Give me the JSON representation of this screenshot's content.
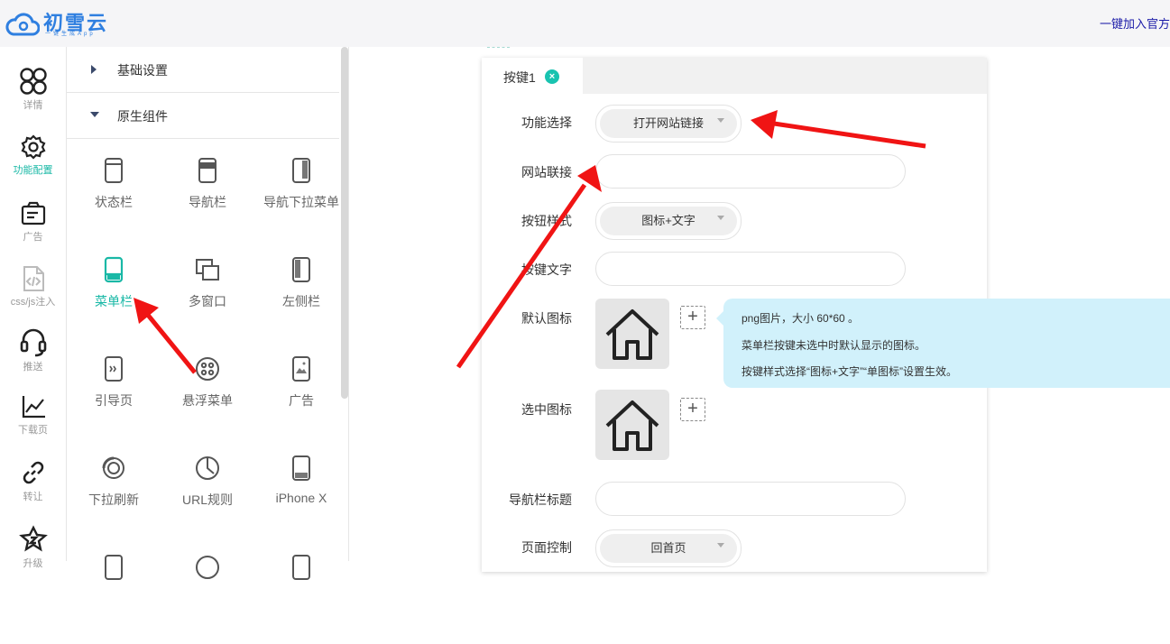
{
  "header": {
    "logo_name": "初雪云",
    "logo_sub": "一键生成App",
    "link": "一键加入官方"
  },
  "leftnav": [
    {
      "label": "详情",
      "icon": "clover-icon"
    },
    {
      "label": "功能配置",
      "icon": "gear-icon",
      "active": true
    },
    {
      "label": "广告",
      "icon": "ad-card-icon"
    },
    {
      "label": "css/js注入",
      "icon": "code-file-icon"
    },
    {
      "label": "推送",
      "icon": "headset-icon"
    },
    {
      "label": "下载页",
      "icon": "line-chart-icon"
    },
    {
      "label": "转让",
      "icon": "link-icon"
    },
    {
      "label": "升级",
      "icon": "star-badge-icon"
    }
  ],
  "panel": {
    "sections": [
      "基础设置",
      "原生组件"
    ],
    "components": [
      {
        "label": "状态栏",
        "icon": "status-bar-icon"
      },
      {
        "label": "导航栏",
        "icon": "nav-bar-icon"
      },
      {
        "label": "导航下拉菜单",
        "icon": "nav-dropdown-icon"
      },
      {
        "label": "菜单栏",
        "icon": "menu-bar-icon",
        "active": true
      },
      {
        "label": "多窗口",
        "icon": "multi-window-icon"
      },
      {
        "label": "左侧栏",
        "icon": "left-sidebar-icon"
      },
      {
        "label": "引导页",
        "icon": "guide-page-icon"
      },
      {
        "label": "悬浮菜单",
        "icon": "float-menu-icon"
      },
      {
        "label": "广告",
        "icon": "ad-image-icon"
      },
      {
        "label": "下拉刷新",
        "icon": "pull-refresh-icon"
      },
      {
        "label": "URL规则",
        "icon": "url-rule-icon"
      },
      {
        "label": "iPhone X",
        "icon": "iphone-x-icon"
      }
    ]
  },
  "editor": {
    "tab_label": "按键1",
    "rows": {
      "function_label": "功能选择",
      "function_value": "打开网站链接",
      "url_label": "网站联接",
      "url_value": "",
      "style_label": "按钮样式",
      "style_value": "图标+文字",
      "text_label": "按键文字",
      "text_value": "",
      "default_icon_label": "默认图标",
      "selected_icon_label": "选中图标",
      "nav_title_label": "导航栏标题",
      "nav_title_value": "",
      "page_control_label": "页面控制",
      "page_control_value": "回首页"
    },
    "add_glyph": "+",
    "tooltip": [
      "png图片，大小 60*60 。",
      "菜单栏按键未选中时默认显示的图标。",
      "按键样式选择“图标+文字”“单图标”设置生效。"
    ]
  },
  "colors": {
    "accent": "#19b8a6",
    "brand": "#2f7fe0",
    "tooltip_bg": "#d1f1fb",
    "arrow": "#f01414"
  }
}
